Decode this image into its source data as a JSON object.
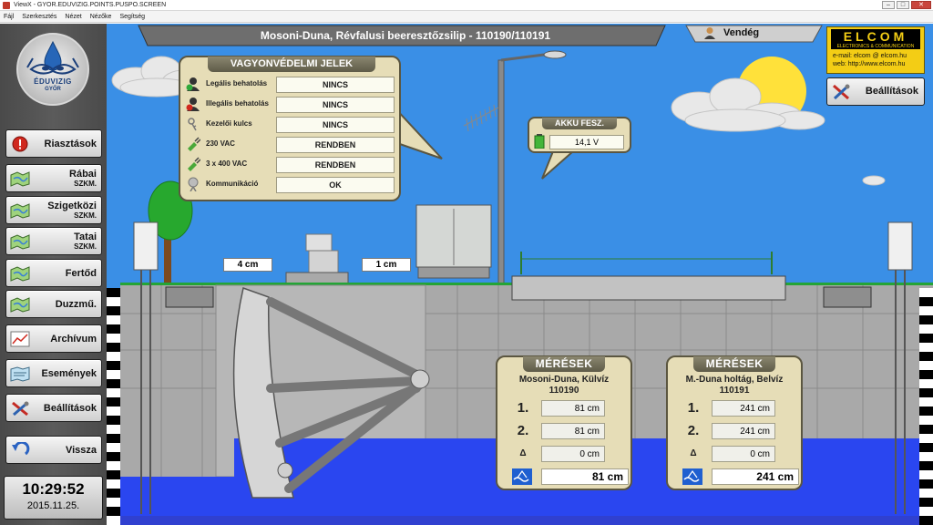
{
  "window": {
    "title": "ViewX - GYOR.EDUVIZIG.POINTS.PUSPO.SCREEN",
    "controls": {
      "minimize": "–",
      "maximize": "□",
      "close": "✕"
    }
  },
  "menubar": [
    "Fájl",
    "Szerkesztés",
    "Nézet",
    "Nézőke",
    "Segítség"
  ],
  "logo": {
    "name": "ÉDUVIZIG",
    "city": "GYŐR"
  },
  "sidebar": {
    "items": [
      {
        "label": "Riasztások",
        "sub": "",
        "icon": "alarm-icon"
      },
      {
        "label": "Rábai",
        "sub": "SZKM.",
        "icon": "map-icon"
      },
      {
        "label": "Szigetközi",
        "sub": "SZKM.",
        "icon": "map-icon"
      },
      {
        "label": "Tatai",
        "sub": "SZKM.",
        "icon": "map-icon"
      },
      {
        "label": "Fertőd",
        "sub": "",
        "icon": "map-icon"
      },
      {
        "label": "Duzzmű.",
        "sub": "",
        "icon": "map-icon"
      },
      {
        "label": "Archívum",
        "sub": "",
        "icon": "chart-icon"
      },
      {
        "label": "Események",
        "sub": "",
        "icon": "events-icon"
      },
      {
        "label": "Beállítások",
        "sub": "",
        "icon": "tools-icon"
      },
      {
        "label": "Vissza",
        "sub": "",
        "icon": "back-arrow-icon"
      }
    ]
  },
  "clock": {
    "time": "10:29:52",
    "date": "2015.11.25."
  },
  "header": {
    "title": "Mosoni-Duna, Révfalusi beeresztőzsilip - 110190/110191"
  },
  "user": {
    "label": "Vendég",
    "icon": "user-icon"
  },
  "elcom": {
    "name": "ELCOM",
    "subtitle": "ELECTRONICS & COMMUNICATION",
    "email": "e-mail: elcom @ elcom.hu",
    "web": "web:  http://www.elcom.hu"
  },
  "settings_button": {
    "label": "Beállítások",
    "icon": "tools-icon"
  },
  "security": {
    "title": "VAGYONVÉDELMI JELEK",
    "rows": [
      {
        "label": "Legális behatolás",
        "value": "NINCS",
        "icon": "intruder-legal-icon"
      },
      {
        "label": "Illegális behatolás",
        "value": "NINCS",
        "icon": "intruder-illegal-icon"
      },
      {
        "label": "Kezelői kulcs",
        "value": "NINCS",
        "icon": "keys-icon"
      },
      {
        "label": "230 VAC",
        "value": "RENDBEN",
        "icon": "plug-icon"
      },
      {
        "label": "3 x 400 VAC",
        "value": "RENDBEN",
        "icon": "plug-icon"
      },
      {
        "label": "Kommunikáció",
        "value": "OK",
        "icon": "communication-icon"
      }
    ]
  },
  "akku": {
    "title": "AKKU FESZ.",
    "value": "14,1 V",
    "icon": "battery-icon"
  },
  "levels": {
    "left": "4 cm",
    "right": "1 cm"
  },
  "measurements": [
    {
      "title": "MÉRÉSEK",
      "name": "Mosoni-Duna, Külvíz",
      "code": "110190",
      "rows": [
        {
          "key": "1.",
          "value": "81 cm"
        },
        {
          "key": "2.",
          "value": "81 cm"
        },
        {
          "key": "Δ",
          "value": "0 cm"
        }
      ],
      "result": "81 cm"
    },
    {
      "title": "MÉRÉSEK",
      "name": "M.-Duna holtág, Belvíz",
      "code": "110191",
      "rows": [
        {
          "key": "1.",
          "value": "241 cm"
        },
        {
          "key": "2.",
          "value": "241 cm"
        },
        {
          "key": "Δ",
          "value": "0 cm"
        }
      ],
      "result": "241 cm"
    }
  ],
  "colors": {
    "sky": "#3a8fe6",
    "water": "#2a46f0",
    "wall": "#a9a9a9",
    "panel": "#e6ddb7",
    "sidebar": "#4f4f4f",
    "elcom_yellow": "#f3cd15",
    "grass": "#24a436"
  }
}
